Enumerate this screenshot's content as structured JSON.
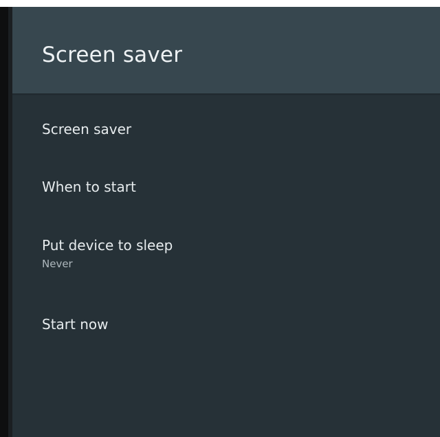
{
  "header": {
    "title": "Screen saver"
  },
  "menu": {
    "items": [
      {
        "title": "Screen saver"
      },
      {
        "title": "When to start"
      },
      {
        "title": "Put device to sleep",
        "subtitle": "Never"
      },
      {
        "title": "Start now"
      }
    ]
  },
  "colors": {
    "header_background": "#37474f",
    "panel_background": "#263137",
    "primary_text": "#e7ecee",
    "secondary_text": "#aeb8bd"
  }
}
